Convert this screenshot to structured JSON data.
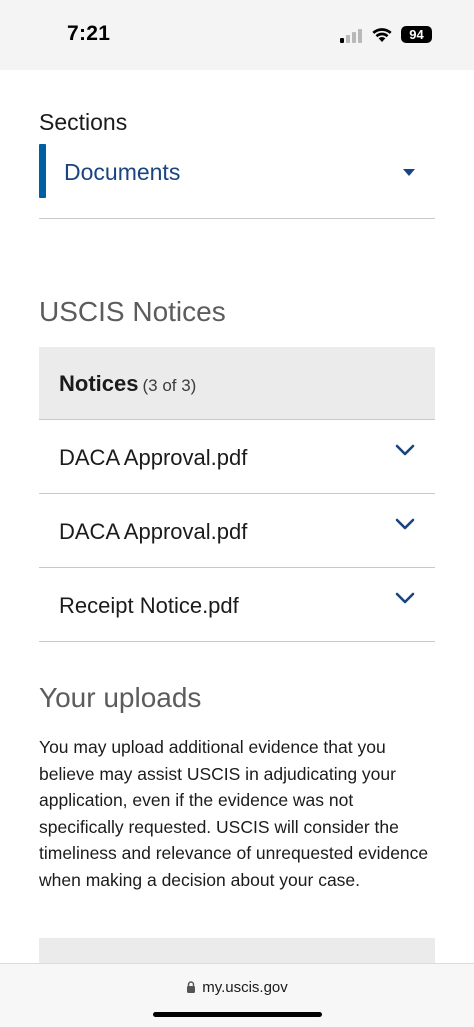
{
  "status_bar": {
    "time": "7:21",
    "battery": "94"
  },
  "sections": {
    "label": "Sections",
    "selected": "Documents"
  },
  "notices": {
    "heading": "USCIS Notices",
    "table_title": "Notices",
    "count": "(3 of 3)",
    "items": [
      {
        "name": "DACA Approval.pdf"
      },
      {
        "name": "DACA Approval.pdf"
      },
      {
        "name": "Receipt Notice.pdf"
      }
    ]
  },
  "uploads": {
    "heading": "Your uploads",
    "description": "You may upload additional evidence that you believe may assist USCIS in adjudicating your application, even if the evidence was not specifically requested. USCIS will consider the timeliness and relevance of unrequested evidence when making a decision about your case."
  },
  "browser": {
    "url": "my.uscis.gov"
  },
  "colors": {
    "accent": "#005ea2",
    "link": "#1a4480",
    "header_bg": "#ebebeb"
  }
}
